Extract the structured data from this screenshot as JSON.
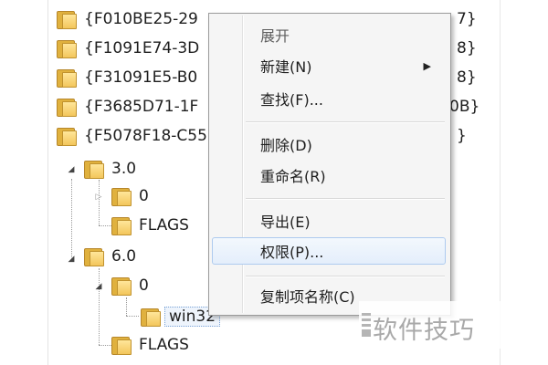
{
  "tree": {
    "top_keys": [
      {
        "left": "{F010BE25-29",
        "right": "7}"
      },
      {
        "left": "{F1091E74-3D",
        "right": "8}"
      },
      {
        "left": "{F31091E5-B0",
        "right": "8}"
      },
      {
        "left": "{F3685D71-1F",
        "right": "0B}"
      },
      {
        "left": "{F5078F18-C55",
        "right": "}"
      }
    ],
    "nodes": {
      "v30": "3.0",
      "v30_zero": "0",
      "v30_flags": "FLAGS",
      "v60": "6.0",
      "v60_zero": "0",
      "win32": "win32",
      "v60_flags": "FLAGS"
    }
  },
  "context_menu": {
    "items": [
      {
        "label": "展开",
        "disabled": true
      },
      {
        "label": "新建(N)",
        "submenu": true
      },
      {
        "label": "查找(F)..."
      },
      {
        "label": "删除(D)"
      },
      {
        "label": "重命名(R)"
      },
      {
        "label": "导出(E)"
      },
      {
        "label": "权限(P)...",
        "highlighted": true
      },
      {
        "label": "复制项名称(C)"
      }
    ]
  },
  "watermark": {
    "text": "软件技巧"
  },
  "icons": {
    "folder": "folder-icon",
    "expand": "expanded-arrow-icon",
    "collapse": "collapsed-arrow-icon",
    "submenu": "submenu-arrow-icon"
  }
}
